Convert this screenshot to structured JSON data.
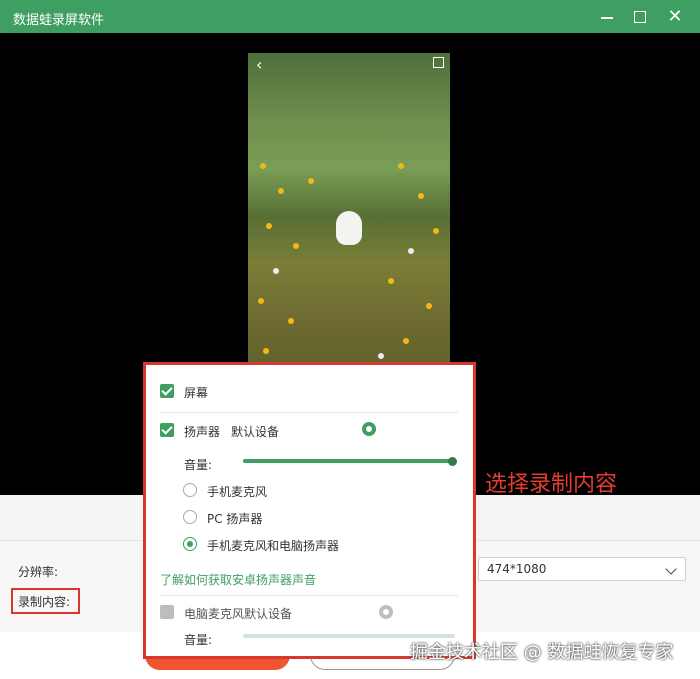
{
  "window": {
    "title": "数据蛙录屏软件",
    "controls": {
      "minimize": "minimize-icon",
      "maximize": "maximize-icon",
      "close_glyph": "✕"
    }
  },
  "preview": {
    "back_glyph": "‹",
    "icons": [
      "back-icon",
      "expand-icon"
    ]
  },
  "popup": {
    "screen": {
      "label": "屏幕",
      "checked": true
    },
    "speaker": {
      "label": "扬声器",
      "device": "默认设备",
      "checked": true
    },
    "speaker_volume_label": "音量:",
    "speaker_volume": 1.0,
    "radio_options": [
      "手机麦克风",
      "PC 扬声器",
      "手机麦克风和电脑扬声器"
    ],
    "radio_selected": 2,
    "link": "了解如何获取安卓扬声器声音",
    "mic": {
      "label": "电脑麦克风默认设备",
      "checked": false
    },
    "mic_volume_label": "音量:"
  },
  "settings": {
    "resolution_label": "分辨率:",
    "resolution_value": "474*1080",
    "content_label": "录制内容:"
  },
  "annotation": "选择录制内容",
  "watermark": "掘金技术社区 @ 数据蛙恢复专家",
  "colors": {
    "brand_green": "#3f9e62",
    "annotation_red": "#d8372f",
    "record_orange": "#f0552f"
  }
}
